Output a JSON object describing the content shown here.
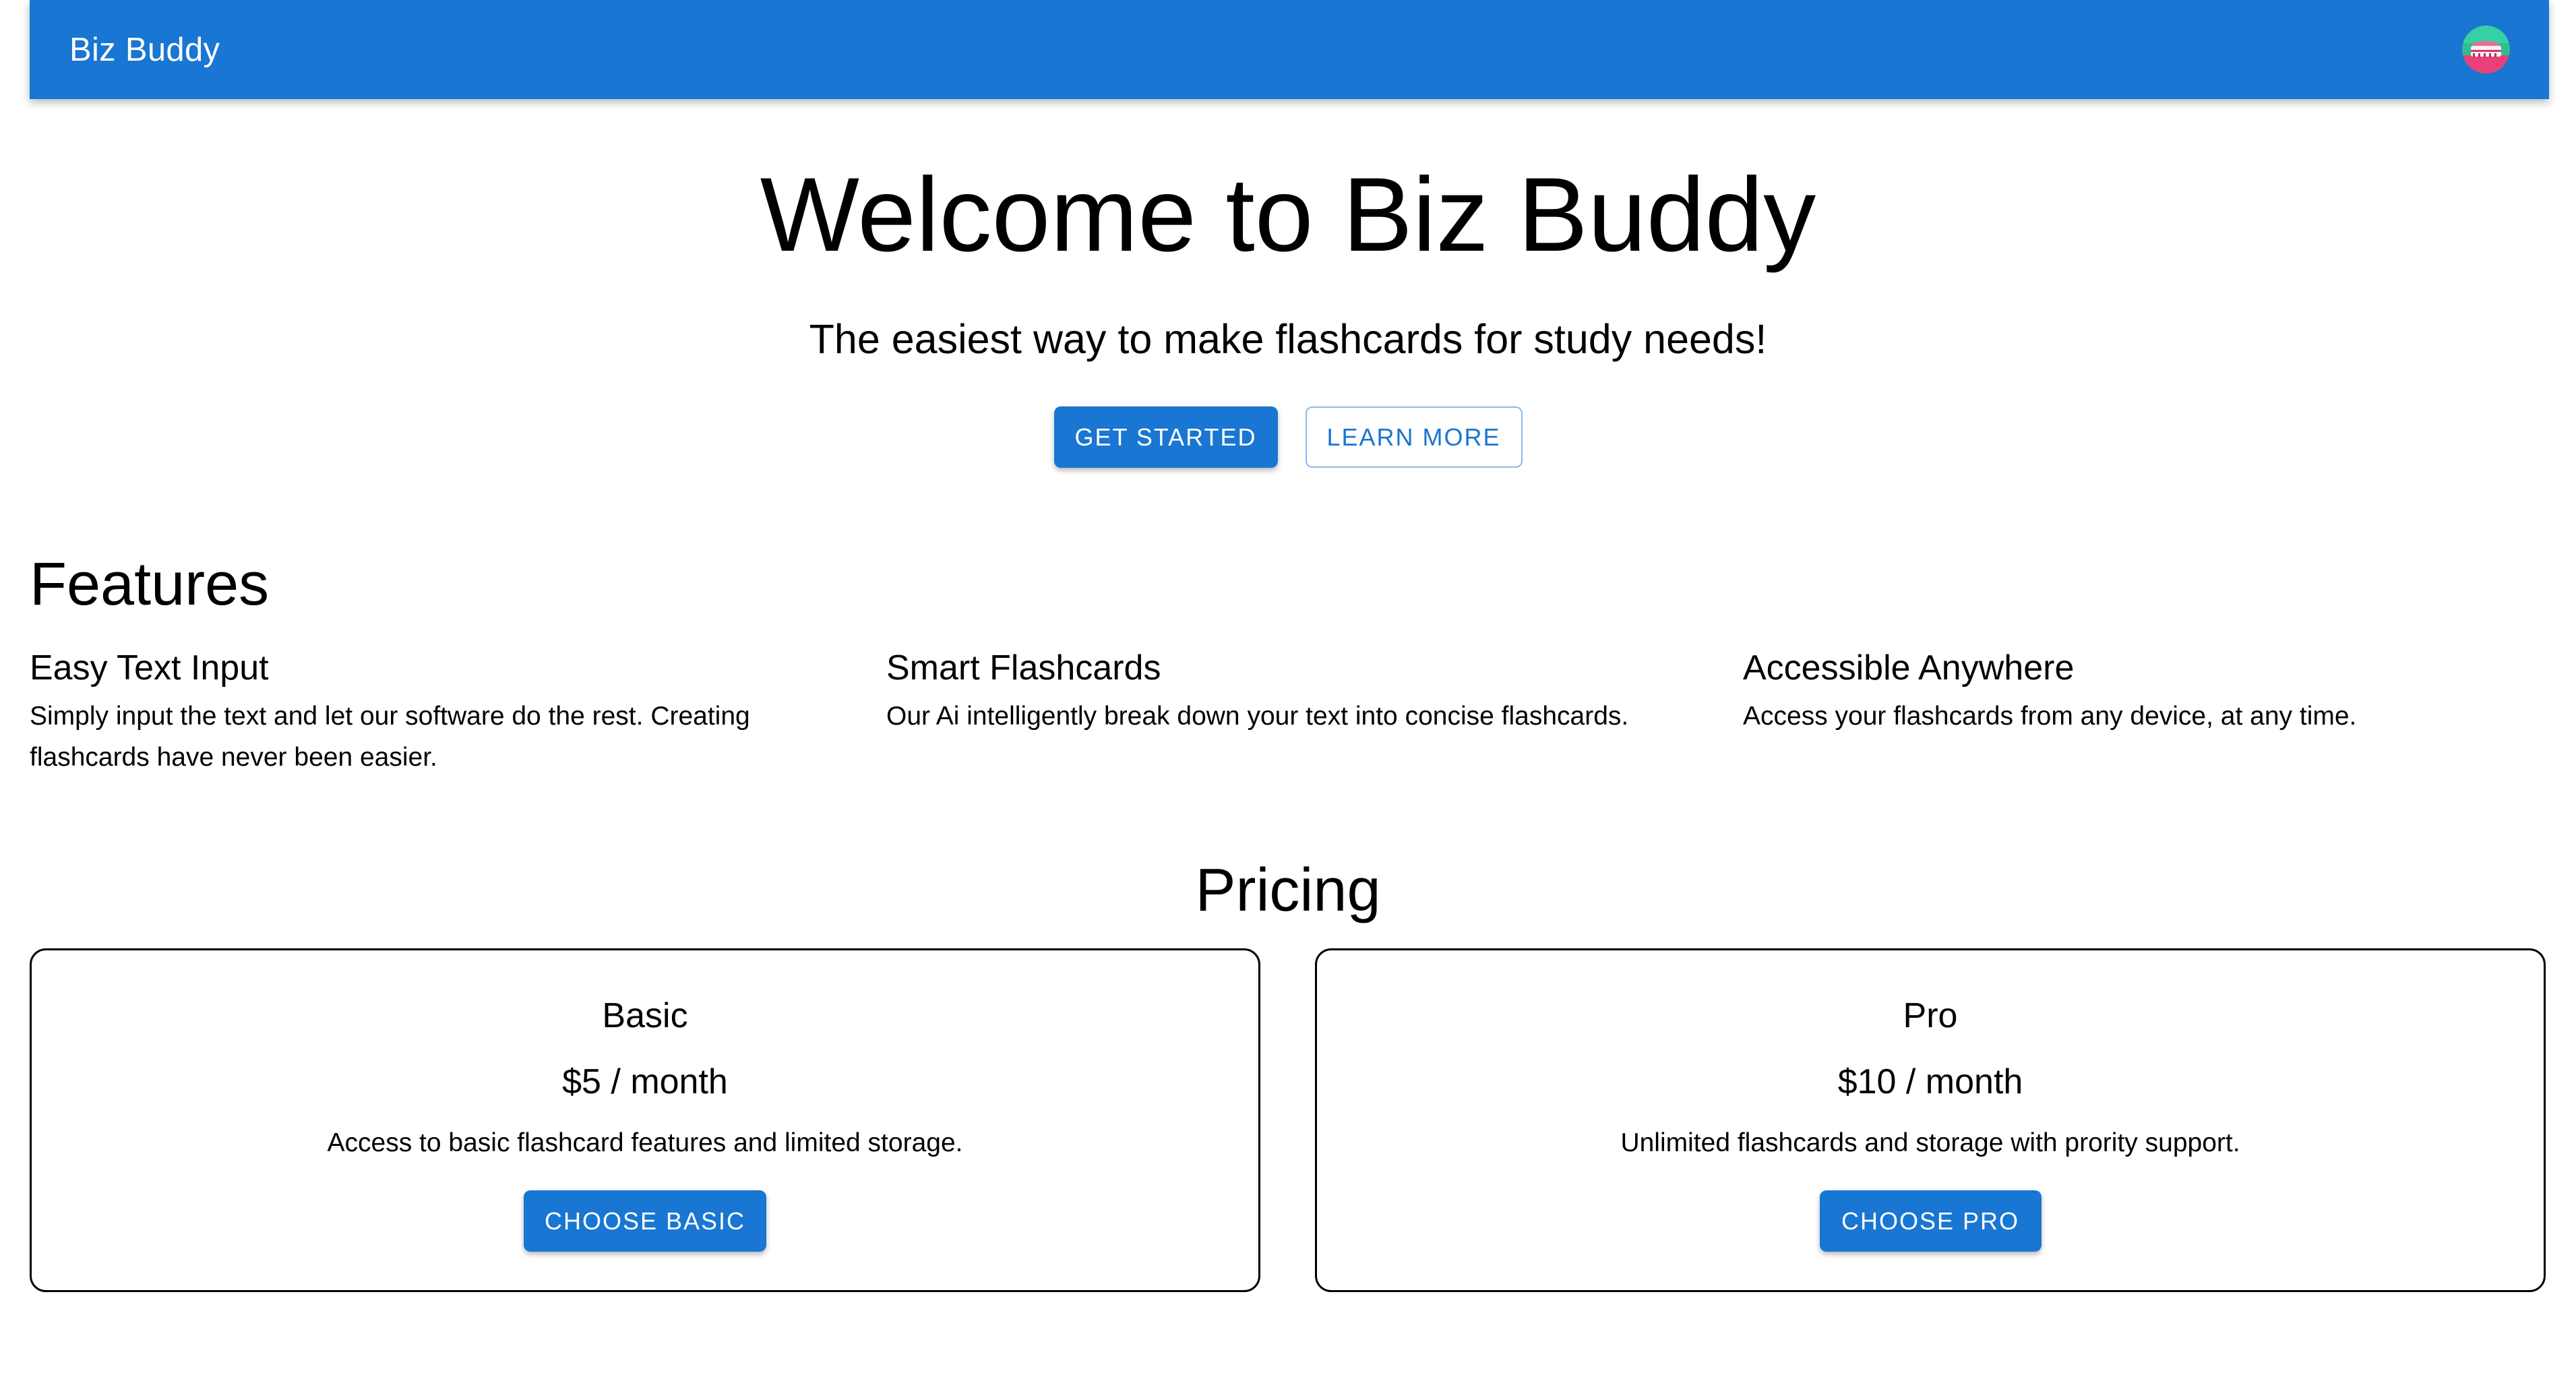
{
  "app": {
    "title": "Biz Buddy",
    "brand_color": "#1976d2",
    "avatar_icon": "avatar-image"
  },
  "hero": {
    "title": "Welcome to Biz Buddy",
    "subtitle": "The easiest way to make flashcards for study needs!",
    "primary_button": "Get Started",
    "secondary_button": "Learn More"
  },
  "features": {
    "heading": "Features",
    "items": [
      {
        "title": "Easy Text Input",
        "description": "Simply input the text and let our software do the rest. Creating flashcards have never been easier."
      },
      {
        "title": "Smart Flashcards",
        "description": "Our Ai intelligently break down your text into concise flashcards."
      },
      {
        "title": "Accessible Anywhere",
        "description": "Access your flashcards from any device, at any time."
      }
    ]
  },
  "pricing": {
    "heading": "Pricing",
    "plans": [
      {
        "name": "Basic",
        "price": "$5 / month",
        "description": "Access to basic flashcard features and limited storage.",
        "button": "Choose Basic"
      },
      {
        "name": "Pro",
        "price": "$10 / month",
        "description": "Unlimited flashcards and storage with prority support.",
        "button": "Choose Pro"
      }
    ]
  }
}
